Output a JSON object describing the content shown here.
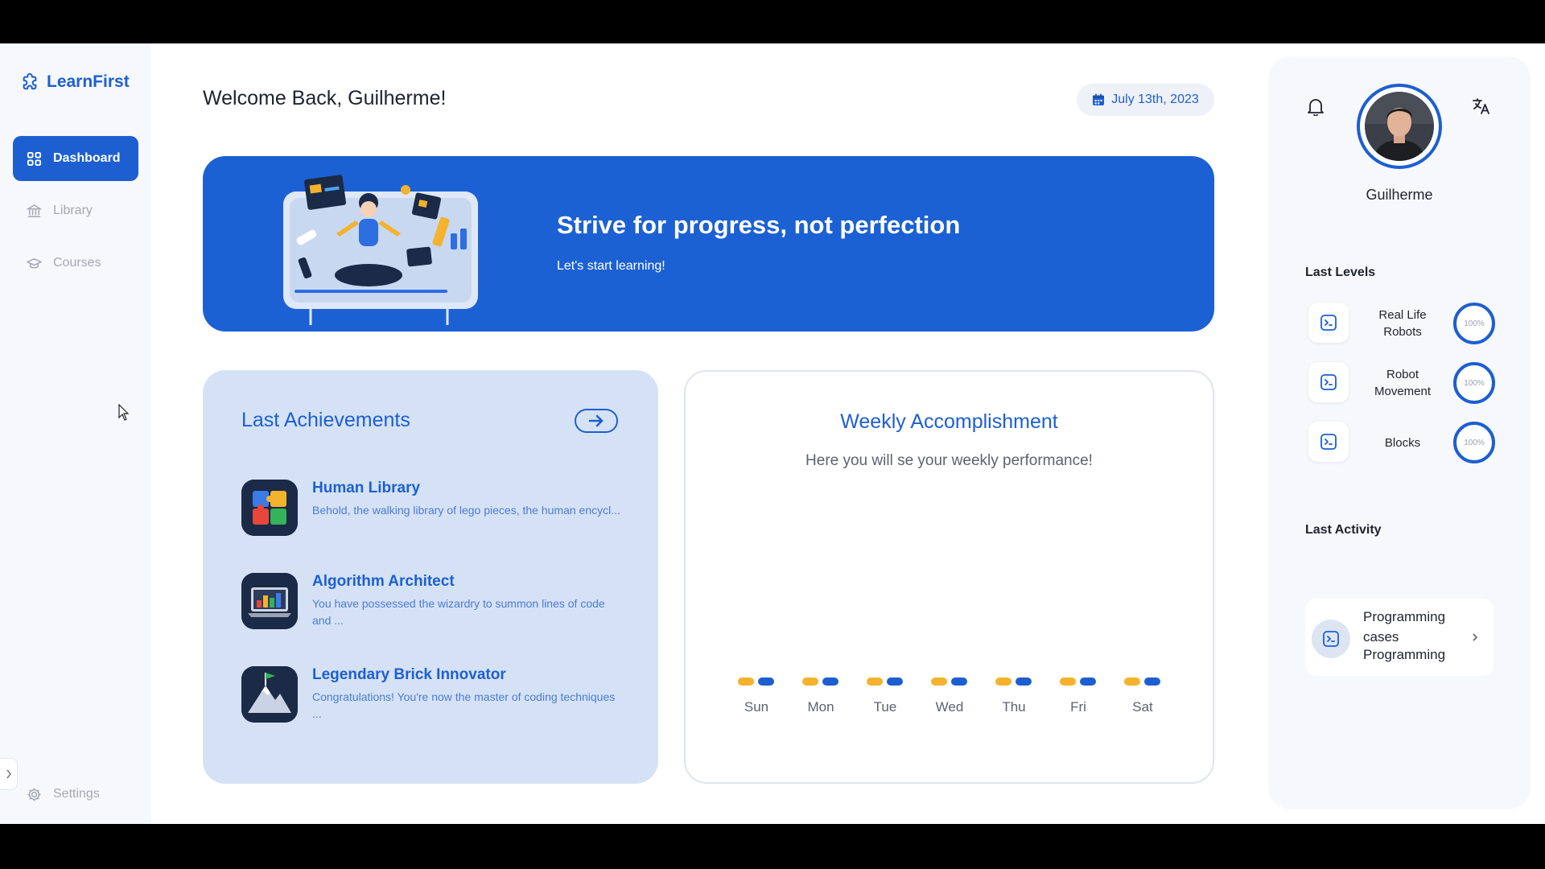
{
  "app": {
    "name": "LearnFirst",
    "brand_color": "#1d5fd1"
  },
  "sidebar": {
    "items": [
      {
        "label": "Dashboard",
        "icon": "grid-icon",
        "active": true
      },
      {
        "label": "Library",
        "icon": "library-icon",
        "active": false
      },
      {
        "label": "Courses",
        "icon": "graduation-cap-icon",
        "active": false
      }
    ],
    "settings_label": "Settings",
    "collapse_icon": "chevron-right-icon"
  },
  "header": {
    "welcome": "Welcome Back, Guilherme!",
    "date": "July 13th, 2023",
    "date_icon": "calendar-icon"
  },
  "banner": {
    "title": "Strive for progress, not perfection",
    "subtitle": "Let's start learning!"
  },
  "achievements": {
    "title": "Last Achievements",
    "action_icon": "arrow-right-icon",
    "items": [
      {
        "name": "Human Library",
        "desc": "Behold, the walking library of lego pieces, the human encycl...",
        "icon": "puzzle-icon"
      },
      {
        "name": "Algorithm Architect",
        "desc": "You have possessed the wizardry to summon lines of code and ...",
        "icon": "laptop-chart-icon"
      },
      {
        "name": "Legendary Brick Innovator",
        "desc": "Congratulations! You're now the master of coding techniques ...",
        "icon": "mountain-flag-icon"
      }
    ]
  },
  "weekly": {
    "title": "Weekly Accomplishment",
    "subtitle": "Here you will se your weekly performance!",
    "days": [
      "Sun",
      "Mon",
      "Tue",
      "Wed",
      "Thu",
      "Fri",
      "Sat"
    ],
    "series_colors": [
      "#f5b22d",
      "#1d5fd1"
    ]
  },
  "profile": {
    "name": "Guilherme",
    "bell_icon": "bell-icon",
    "translate_icon": "translate-icon",
    "last_levels_title": "Last Levels",
    "levels": [
      {
        "name": "Real Life Robots",
        "progress": "100%"
      },
      {
        "name": "Robot Movement",
        "progress": "100%"
      },
      {
        "name": "Blocks",
        "progress": "100%"
      }
    ],
    "last_activity_title": "Last Activity",
    "activity": {
      "title": "Programming cases",
      "subtitle": "Programming"
    }
  }
}
